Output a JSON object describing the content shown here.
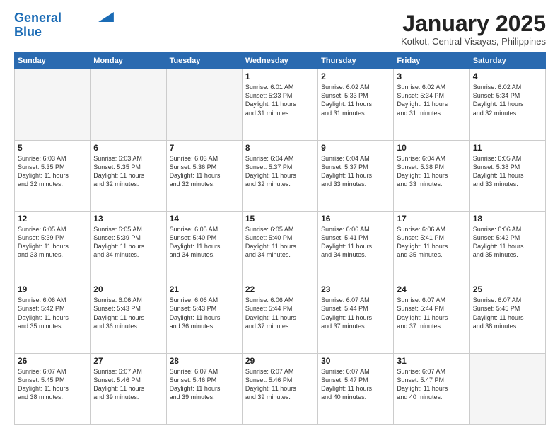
{
  "header": {
    "logo_line1": "General",
    "logo_line2": "Blue",
    "title": "January 2025",
    "subtitle": "Kotkot, Central Visayas, Philippines"
  },
  "days_of_week": [
    "Sunday",
    "Monday",
    "Tuesday",
    "Wednesday",
    "Thursday",
    "Friday",
    "Saturday"
  ],
  "weeks": [
    [
      {
        "day": "",
        "info": ""
      },
      {
        "day": "",
        "info": ""
      },
      {
        "day": "",
        "info": ""
      },
      {
        "day": "1",
        "info": "Sunrise: 6:01 AM\nSunset: 5:33 PM\nDaylight: 11 hours\nand 31 minutes."
      },
      {
        "day": "2",
        "info": "Sunrise: 6:02 AM\nSunset: 5:33 PM\nDaylight: 11 hours\nand 31 minutes."
      },
      {
        "day": "3",
        "info": "Sunrise: 6:02 AM\nSunset: 5:34 PM\nDaylight: 11 hours\nand 31 minutes."
      },
      {
        "day": "4",
        "info": "Sunrise: 6:02 AM\nSunset: 5:34 PM\nDaylight: 11 hours\nand 32 minutes."
      }
    ],
    [
      {
        "day": "5",
        "info": "Sunrise: 6:03 AM\nSunset: 5:35 PM\nDaylight: 11 hours\nand 32 minutes."
      },
      {
        "day": "6",
        "info": "Sunrise: 6:03 AM\nSunset: 5:35 PM\nDaylight: 11 hours\nand 32 minutes."
      },
      {
        "day": "7",
        "info": "Sunrise: 6:03 AM\nSunset: 5:36 PM\nDaylight: 11 hours\nand 32 minutes."
      },
      {
        "day": "8",
        "info": "Sunrise: 6:04 AM\nSunset: 5:37 PM\nDaylight: 11 hours\nand 32 minutes."
      },
      {
        "day": "9",
        "info": "Sunrise: 6:04 AM\nSunset: 5:37 PM\nDaylight: 11 hours\nand 33 minutes."
      },
      {
        "day": "10",
        "info": "Sunrise: 6:04 AM\nSunset: 5:38 PM\nDaylight: 11 hours\nand 33 minutes."
      },
      {
        "day": "11",
        "info": "Sunrise: 6:05 AM\nSunset: 5:38 PM\nDaylight: 11 hours\nand 33 minutes."
      }
    ],
    [
      {
        "day": "12",
        "info": "Sunrise: 6:05 AM\nSunset: 5:39 PM\nDaylight: 11 hours\nand 33 minutes."
      },
      {
        "day": "13",
        "info": "Sunrise: 6:05 AM\nSunset: 5:39 PM\nDaylight: 11 hours\nand 34 minutes."
      },
      {
        "day": "14",
        "info": "Sunrise: 6:05 AM\nSunset: 5:40 PM\nDaylight: 11 hours\nand 34 minutes."
      },
      {
        "day": "15",
        "info": "Sunrise: 6:05 AM\nSunset: 5:40 PM\nDaylight: 11 hours\nand 34 minutes."
      },
      {
        "day": "16",
        "info": "Sunrise: 6:06 AM\nSunset: 5:41 PM\nDaylight: 11 hours\nand 34 minutes."
      },
      {
        "day": "17",
        "info": "Sunrise: 6:06 AM\nSunset: 5:41 PM\nDaylight: 11 hours\nand 35 minutes."
      },
      {
        "day": "18",
        "info": "Sunrise: 6:06 AM\nSunset: 5:42 PM\nDaylight: 11 hours\nand 35 minutes."
      }
    ],
    [
      {
        "day": "19",
        "info": "Sunrise: 6:06 AM\nSunset: 5:42 PM\nDaylight: 11 hours\nand 35 minutes."
      },
      {
        "day": "20",
        "info": "Sunrise: 6:06 AM\nSunset: 5:43 PM\nDaylight: 11 hours\nand 36 minutes."
      },
      {
        "day": "21",
        "info": "Sunrise: 6:06 AM\nSunset: 5:43 PM\nDaylight: 11 hours\nand 36 minutes."
      },
      {
        "day": "22",
        "info": "Sunrise: 6:06 AM\nSunset: 5:44 PM\nDaylight: 11 hours\nand 37 minutes."
      },
      {
        "day": "23",
        "info": "Sunrise: 6:07 AM\nSunset: 5:44 PM\nDaylight: 11 hours\nand 37 minutes."
      },
      {
        "day": "24",
        "info": "Sunrise: 6:07 AM\nSunset: 5:44 PM\nDaylight: 11 hours\nand 37 minutes."
      },
      {
        "day": "25",
        "info": "Sunrise: 6:07 AM\nSunset: 5:45 PM\nDaylight: 11 hours\nand 38 minutes."
      }
    ],
    [
      {
        "day": "26",
        "info": "Sunrise: 6:07 AM\nSunset: 5:45 PM\nDaylight: 11 hours\nand 38 minutes."
      },
      {
        "day": "27",
        "info": "Sunrise: 6:07 AM\nSunset: 5:46 PM\nDaylight: 11 hours\nand 39 minutes."
      },
      {
        "day": "28",
        "info": "Sunrise: 6:07 AM\nSunset: 5:46 PM\nDaylight: 11 hours\nand 39 minutes."
      },
      {
        "day": "29",
        "info": "Sunrise: 6:07 AM\nSunset: 5:46 PM\nDaylight: 11 hours\nand 39 minutes."
      },
      {
        "day": "30",
        "info": "Sunrise: 6:07 AM\nSunset: 5:47 PM\nDaylight: 11 hours\nand 40 minutes."
      },
      {
        "day": "31",
        "info": "Sunrise: 6:07 AM\nSunset: 5:47 PM\nDaylight: 11 hours\nand 40 minutes."
      },
      {
        "day": "",
        "info": ""
      }
    ]
  ]
}
